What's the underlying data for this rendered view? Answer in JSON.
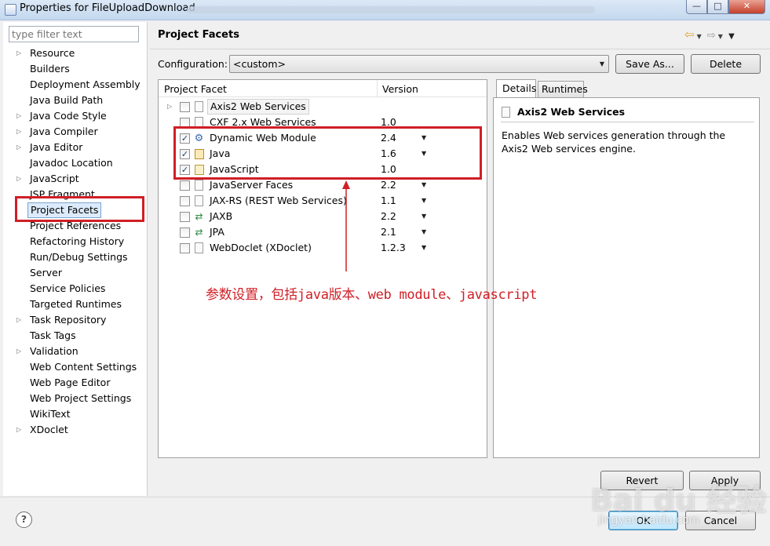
{
  "window": {
    "title": "Properties for FileUploadDownload",
    "controls": {
      "minimize": "—",
      "maximize": "□",
      "close": "✕"
    }
  },
  "filter": {
    "placeholder": "type filter text"
  },
  "tree": {
    "items": [
      {
        "label": "Resource",
        "expandable": true
      },
      {
        "label": "Builders",
        "expandable": false
      },
      {
        "label": "Deployment Assembly",
        "expandable": false
      },
      {
        "label": "Java Build Path",
        "expandable": false
      },
      {
        "label": "Java Code Style",
        "expandable": true
      },
      {
        "label": "Java Compiler",
        "expandable": true
      },
      {
        "label": "Java Editor",
        "expandable": true
      },
      {
        "label": "Javadoc Location",
        "expandable": false
      },
      {
        "label": "JavaScript",
        "expandable": true
      },
      {
        "label": "JSP Fragment",
        "expandable": false
      },
      {
        "label": "Project Facets",
        "expandable": false,
        "selected": true
      },
      {
        "label": "Project References",
        "expandable": false
      },
      {
        "label": "Refactoring History",
        "expandable": false
      },
      {
        "label": "Run/Debug Settings",
        "expandable": false
      },
      {
        "label": "Server",
        "expandable": false
      },
      {
        "label": "Service Policies",
        "expandable": false
      },
      {
        "label": "Targeted Runtimes",
        "expandable": false
      },
      {
        "label": "Task Repository",
        "expandable": true
      },
      {
        "label": "Task Tags",
        "expandable": false
      },
      {
        "label": "Validation",
        "expandable": true
      },
      {
        "label": "Web Content Settings",
        "expandable": false
      },
      {
        "label": "Web Page Editor",
        "expandable": false
      },
      {
        "label": "Web Project Settings",
        "expandable": false
      },
      {
        "label": "WikiText",
        "expandable": false
      },
      {
        "label": "XDoclet",
        "expandable": true
      }
    ]
  },
  "page": {
    "title": "Project Facets"
  },
  "config": {
    "label": "Configuration:",
    "value": "<custom>",
    "save_as": "Save As...",
    "delete": "Delete"
  },
  "facets": {
    "col_facet": "Project Facet",
    "col_version": "Version",
    "rows": [
      {
        "name": "Axis2 Web Services",
        "version": "",
        "checked": false,
        "icon": "doc-icon",
        "expandable": true,
        "boxed": true,
        "dropdown": false
      },
      {
        "name": "CXF 2.x Web Services",
        "version": "1.0",
        "checked": false,
        "icon": "doc-icon",
        "expandable": false,
        "boxed": false,
        "dropdown": false
      },
      {
        "name": "Dynamic Web Module",
        "version": "2.4",
        "checked": true,
        "icon": "web-module-icon",
        "expandable": false,
        "boxed": false,
        "dropdown": true
      },
      {
        "name": "Java",
        "version": "1.6",
        "checked": true,
        "icon": "java-jar-icon",
        "expandable": false,
        "boxed": false,
        "dropdown": true
      },
      {
        "name": "JavaScript",
        "version": "1.0",
        "checked": true,
        "icon": "javascript-icon",
        "expandable": false,
        "boxed": false,
        "dropdown": false
      },
      {
        "name": "JavaServer Faces",
        "version": "2.2",
        "checked": false,
        "icon": "doc-icon",
        "expandable": false,
        "boxed": false,
        "dropdown": true
      },
      {
        "name": "JAX-RS (REST Web Services)",
        "version": "1.1",
        "checked": false,
        "icon": "doc-icon",
        "expandable": false,
        "boxed": false,
        "dropdown": true
      },
      {
        "name": "JAXB",
        "version": "2.2",
        "checked": false,
        "icon": "jaxb-arrows-icon",
        "expandable": false,
        "boxed": false,
        "dropdown": true
      },
      {
        "name": "JPA",
        "version": "2.1",
        "checked": false,
        "icon": "jpa-arrows-icon",
        "expandable": false,
        "boxed": false,
        "dropdown": true
      },
      {
        "name": "WebDoclet (XDoclet)",
        "version": "1.2.3",
        "checked": false,
        "icon": "doc-icon",
        "expandable": false,
        "boxed": false,
        "dropdown": true
      }
    ]
  },
  "details": {
    "tab_details": "Details",
    "tab_runtimes": "Runtimes",
    "title": "Axis2 Web Services",
    "description": "Enables Web services generation through the Axis2 Web services engine."
  },
  "buttons": {
    "revert": "Revert",
    "apply": "Apply",
    "ok": "OK",
    "cancel": "Cancel",
    "help": "?"
  },
  "annotation": {
    "text": "参数设置，包括java版本、web module、javascript",
    "color": "#d01f26"
  },
  "watermark": {
    "text": "Bai du 经验",
    "url": "jingyan.baidu.com"
  }
}
